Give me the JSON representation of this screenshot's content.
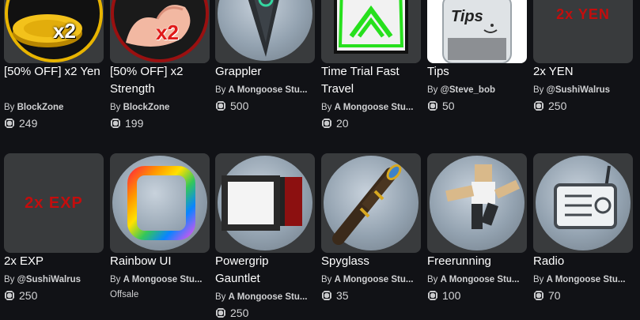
{
  "items": [
    {
      "title": "[50% OFF] x2 Yen",
      "creator_prefix": "By",
      "creator": "BlockZone",
      "price": "249",
      "thumb_label": "x2",
      "thumb_icon": "gold-coin-icon"
    },
    {
      "title": "[50% OFF] x2 Strength",
      "creator_prefix": "By",
      "creator": "BlockZone",
      "price": "199",
      "thumb_label": "x2",
      "thumb_icon": "muscle-arm-icon"
    },
    {
      "title": "Grappler",
      "creator_prefix": "By",
      "creator": "A Mongoose Stu...",
      "price": "500",
      "thumb_icon": "grappler-icon"
    },
    {
      "title": "Time Trial Fast Travel",
      "creator_prefix": "By",
      "creator": "A Mongoose Stu...",
      "price": "20",
      "thumb_icon": "chevron-up-icon"
    },
    {
      "title": "Tips",
      "creator_prefix": "By",
      "creator": "@Steve_bob",
      "price": "50",
      "thumb_label": "Tips",
      "thumb_icon": "tip-jar-icon"
    },
    {
      "title": "2x YEN",
      "creator_prefix": "By",
      "creator": "@SushiWalrus",
      "price": "250",
      "thumb_label": "2x YEN"
    },
    {
      "title": "2x EXP",
      "creator_prefix": "By",
      "creator": "@SushiWalrus",
      "price": "250",
      "thumb_label": "2x EXP"
    },
    {
      "title": "Rainbow UI",
      "creator_prefix": "By",
      "creator": "A Mongoose Stu...",
      "status": "Offsale",
      "thumb_icon": "rainbow-frame-icon"
    },
    {
      "title": "Powergrip Gauntlet",
      "creator_prefix": "By",
      "creator": "A Mongoose Stu...",
      "price": "250",
      "thumb_icon": "gauntlet-icon"
    },
    {
      "title": "Spyglass",
      "creator_prefix": "By",
      "creator": "A Mongoose Stu...",
      "price": "35",
      "thumb_icon": "spyglass-icon"
    },
    {
      "title": "Freerunning",
      "creator_prefix": "By",
      "creator": "A Mongoose Stu...",
      "price": "100",
      "thumb_icon": "runner-icon"
    },
    {
      "title": "Radio",
      "creator_prefix": "By",
      "creator": "A Mongoose Stu...",
      "price": "70",
      "thumb_icon": "radio-icon"
    }
  ],
  "currency_icon": "robux-icon",
  "colors": {
    "background": "#111216",
    "card": "#393b3d",
    "text": "#ffffff",
    "muted": "#d0d1d3",
    "label_red": "#c40d0d"
  }
}
